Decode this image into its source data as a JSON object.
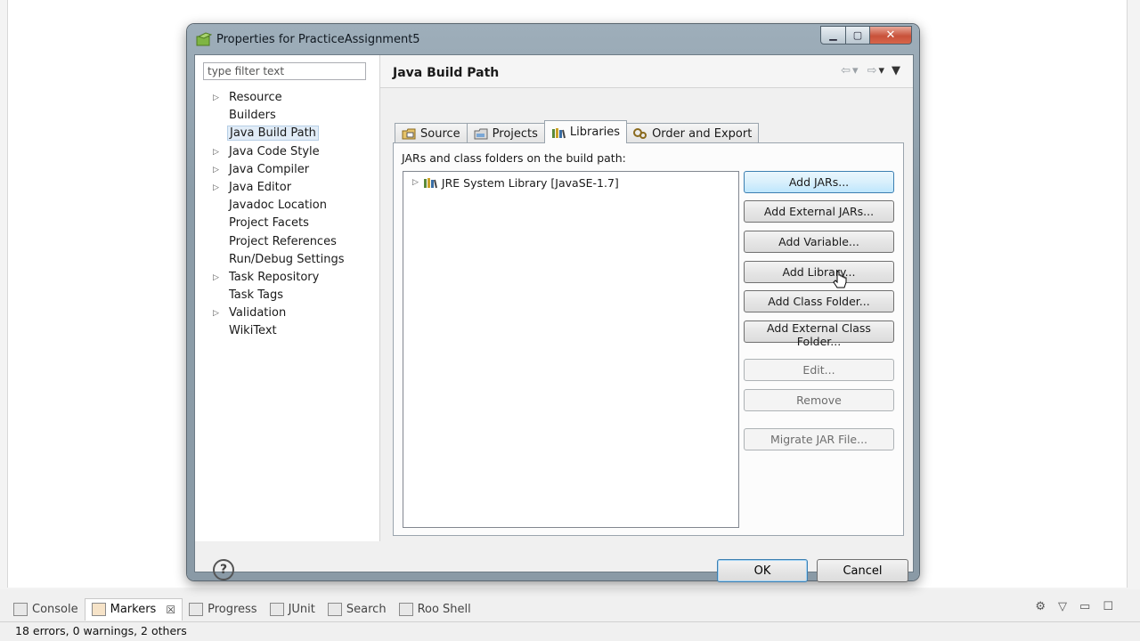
{
  "dialog": {
    "title": "Properties for PracticeAssignment5",
    "filter_placeholder": "type filter text",
    "nav": [
      {
        "label": "Resource",
        "expandable": true
      },
      {
        "label": "Builders",
        "expandable": false
      },
      {
        "label": "Java Build Path",
        "expandable": false,
        "selected": true
      },
      {
        "label": "Java Code Style",
        "expandable": true
      },
      {
        "label": "Java Compiler",
        "expandable": true
      },
      {
        "label": "Java Editor",
        "expandable": true
      },
      {
        "label": "Javadoc Location",
        "expandable": false
      },
      {
        "label": "Project Facets",
        "expandable": false
      },
      {
        "label": "Project References",
        "expandable": false
      },
      {
        "label": "Run/Debug Settings",
        "expandable": false
      },
      {
        "label": "Task Repository",
        "expandable": true
      },
      {
        "label": "Task Tags",
        "expandable": false
      },
      {
        "label": "Validation",
        "expandable": true
      },
      {
        "label": "WikiText",
        "expandable": false
      }
    ],
    "page_title": "Java Build Path",
    "tabs": [
      {
        "label": "Source",
        "icon": "source-folder-icon"
      },
      {
        "label": "Projects",
        "icon": "projects-icon"
      },
      {
        "label": "Libraries",
        "icon": "libraries-icon",
        "active": true
      },
      {
        "label": "Order and Export",
        "icon": "order-export-icon"
      }
    ],
    "libraries_label": "JARs and class folders on the build path:",
    "libraries": [
      {
        "label": "JRE System Library [JavaSE-1.7]",
        "icon": "library-icon"
      }
    ],
    "buttons": {
      "add_jars": "Add JARs...",
      "add_external_jars": "Add External JARs...",
      "add_variable": "Add Variable...",
      "add_library": "Add Library...",
      "add_class_folder": "Add Class Folder...",
      "add_external_class_folder": "Add External Class Folder...",
      "edit": "Edit...",
      "remove": "Remove",
      "migrate_jar": "Migrate JAR File..."
    },
    "ok": "OK",
    "cancel": "Cancel",
    "help_symbol": "?"
  },
  "views": {
    "tabs": [
      {
        "label": "Console",
        "icon": "console-icon"
      },
      {
        "label": "Markers",
        "icon": "markers-icon",
        "active": true
      },
      {
        "label": "Progress",
        "icon": "progress-icon"
      },
      {
        "label": "JUnit",
        "icon": "junit-icon"
      },
      {
        "label": "Search",
        "icon": "search-icon"
      },
      {
        "label": "Roo Shell",
        "icon": "roo-shell-icon"
      }
    ],
    "close_symbol": "☒",
    "status": "18 errors, 0 warnings, 2 others"
  },
  "colors": {
    "accent": "#3c7fb1",
    "titlebar": "#9eaeba",
    "close_button": "#c8523a"
  }
}
